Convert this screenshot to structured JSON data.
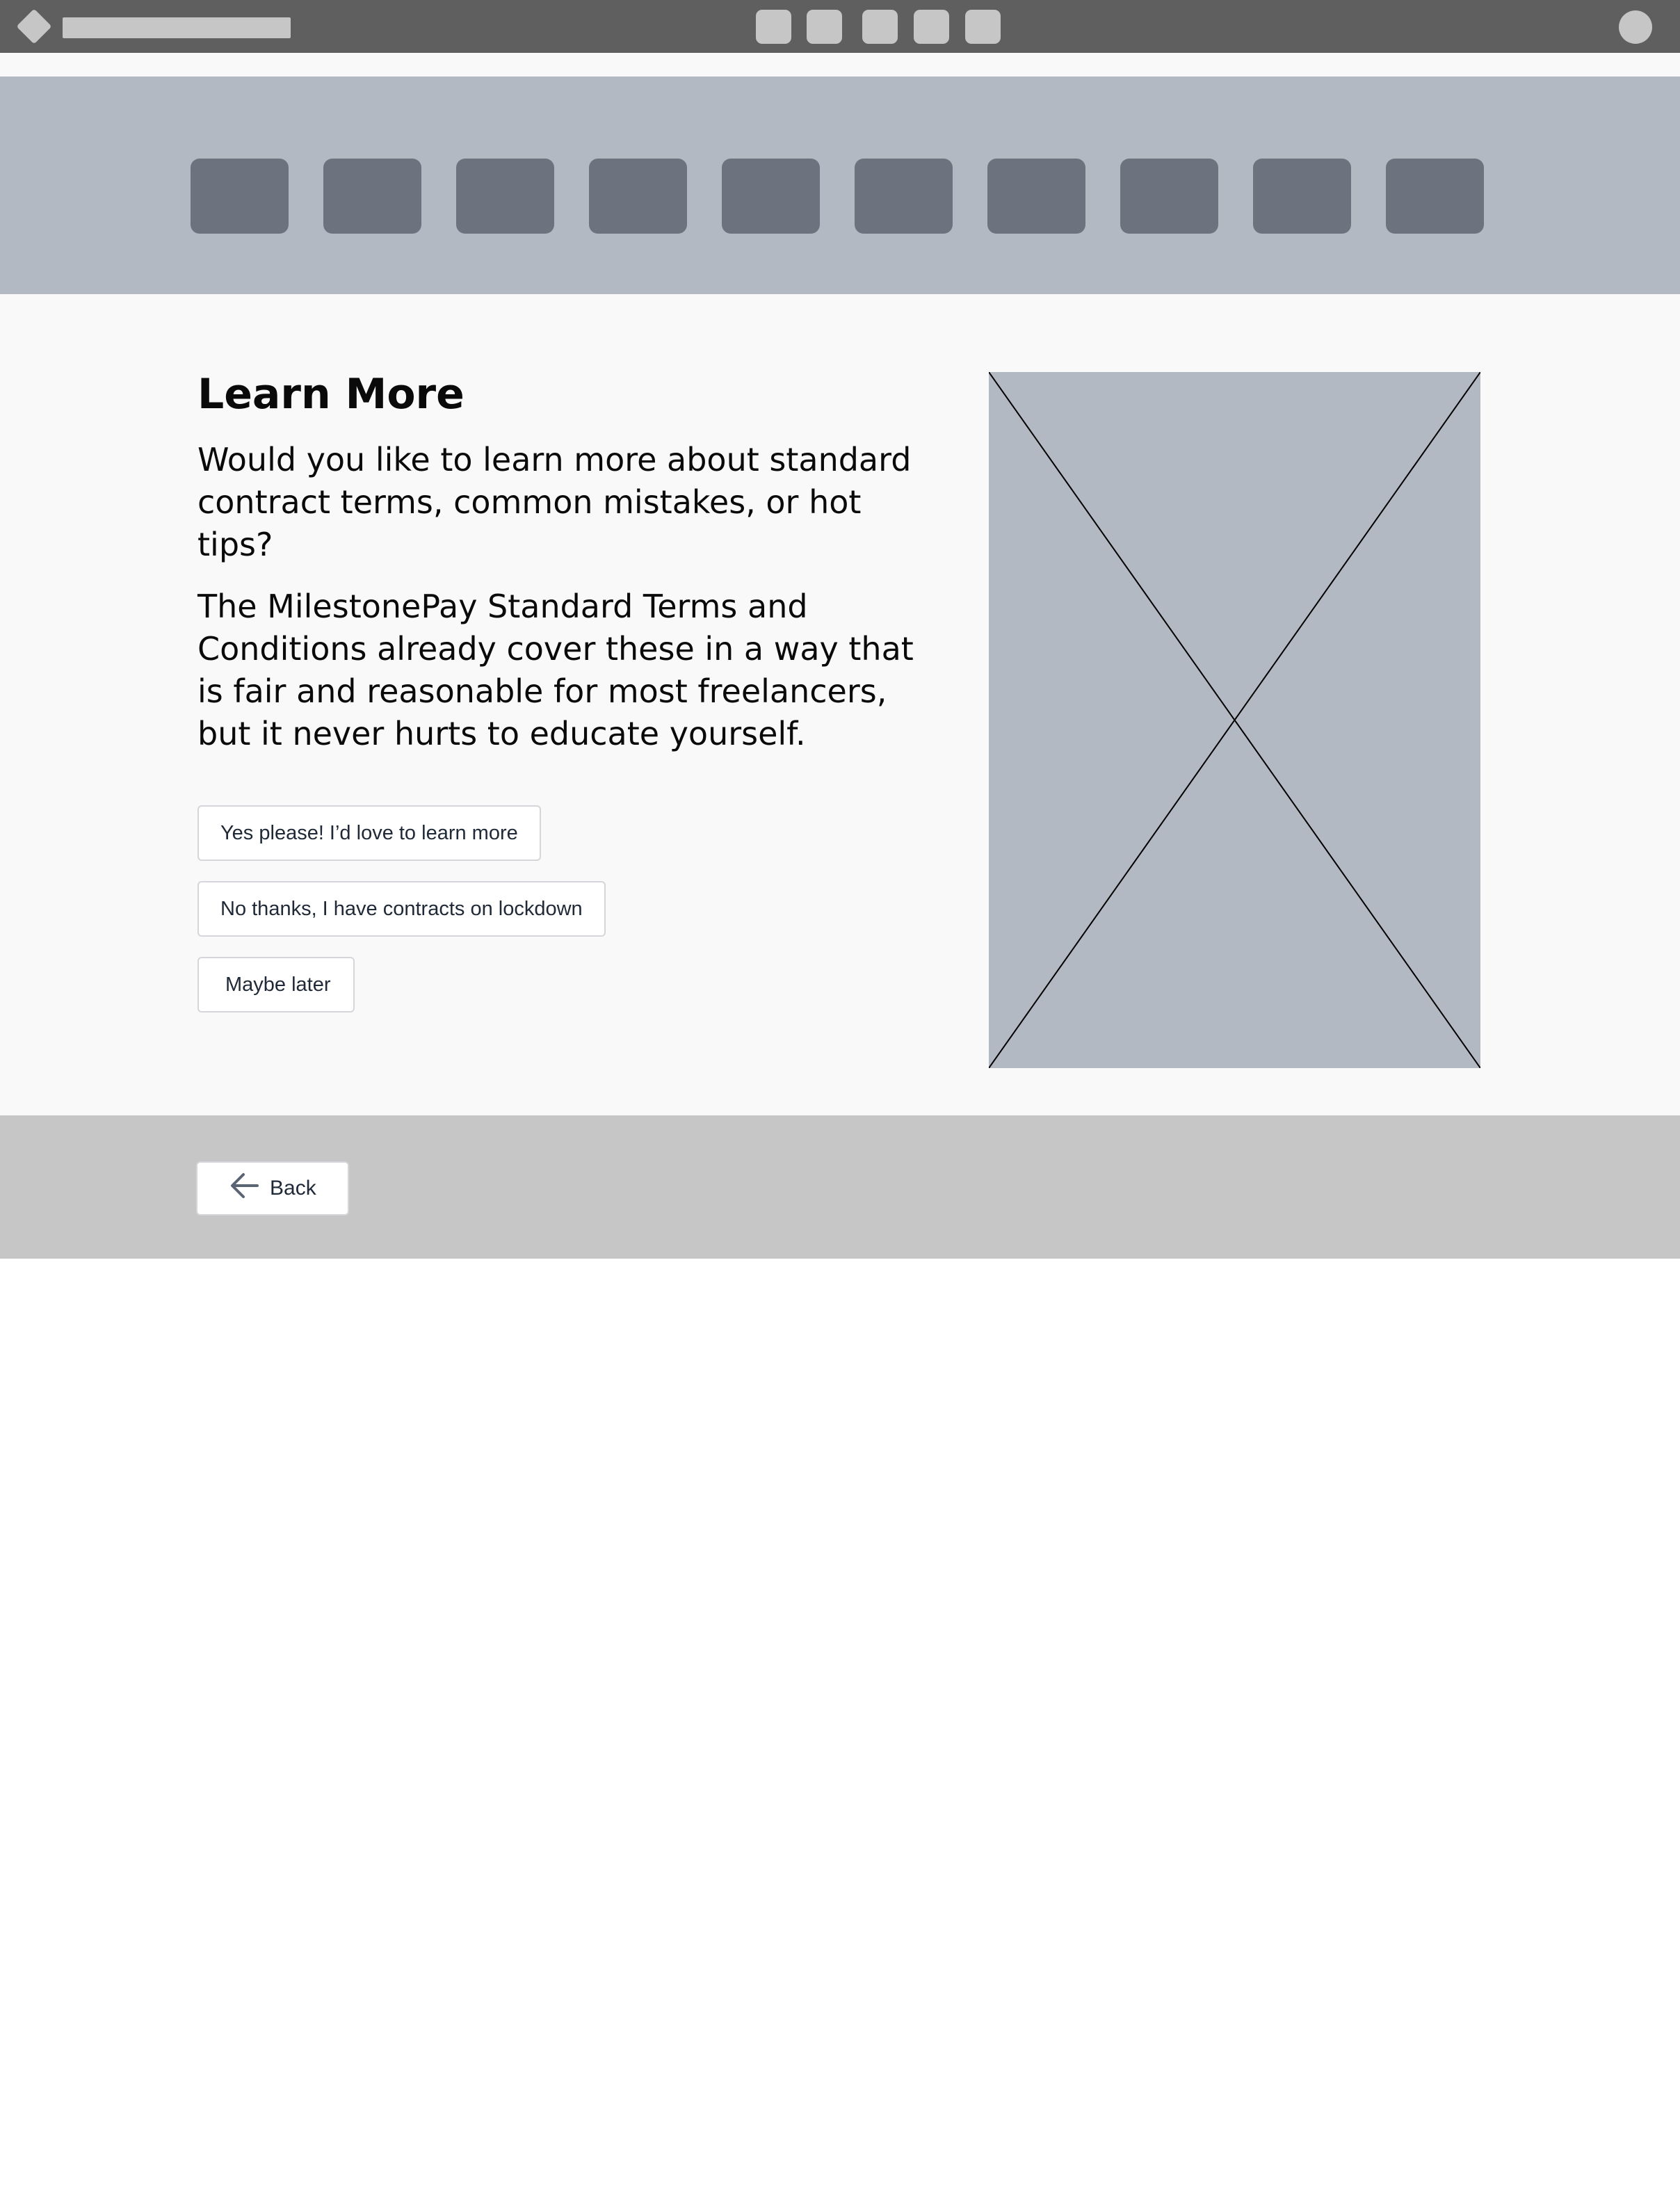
{
  "app": {
    "top_nav_icon_count": 5
  },
  "step_strip": {
    "step_count": 10
  },
  "main": {
    "heading": "Learn More",
    "paragraph_1": "Would you like to learn more about standard contract terms, common mistakes, or hot tips?",
    "paragraph_2": "The MilestonePay Standard Terms and Conditions already cover these in a way that is fair and reasonable for most freelancers, but it never hurts to educate yourself.",
    "options": [
      {
        "label": "Yes please! I’d love to learn more"
      },
      {
        "label": "No thanks, I have contracts on lockdown"
      },
      {
        "label": "Maybe later"
      }
    ],
    "image": {
      "icon": "image-placeholder-icon"
    }
  },
  "footer": {
    "back_label": "Back",
    "back_icon": "arrow-left-icon"
  },
  "colors": {
    "topbar": "#5f5f5f",
    "placeholder_light": "#c6c6c6",
    "step_strip": "#b2b9c2",
    "step_pill": "#6c737e",
    "page_bg": "#f9f9f9",
    "footer": "#c6c6c6"
  }
}
